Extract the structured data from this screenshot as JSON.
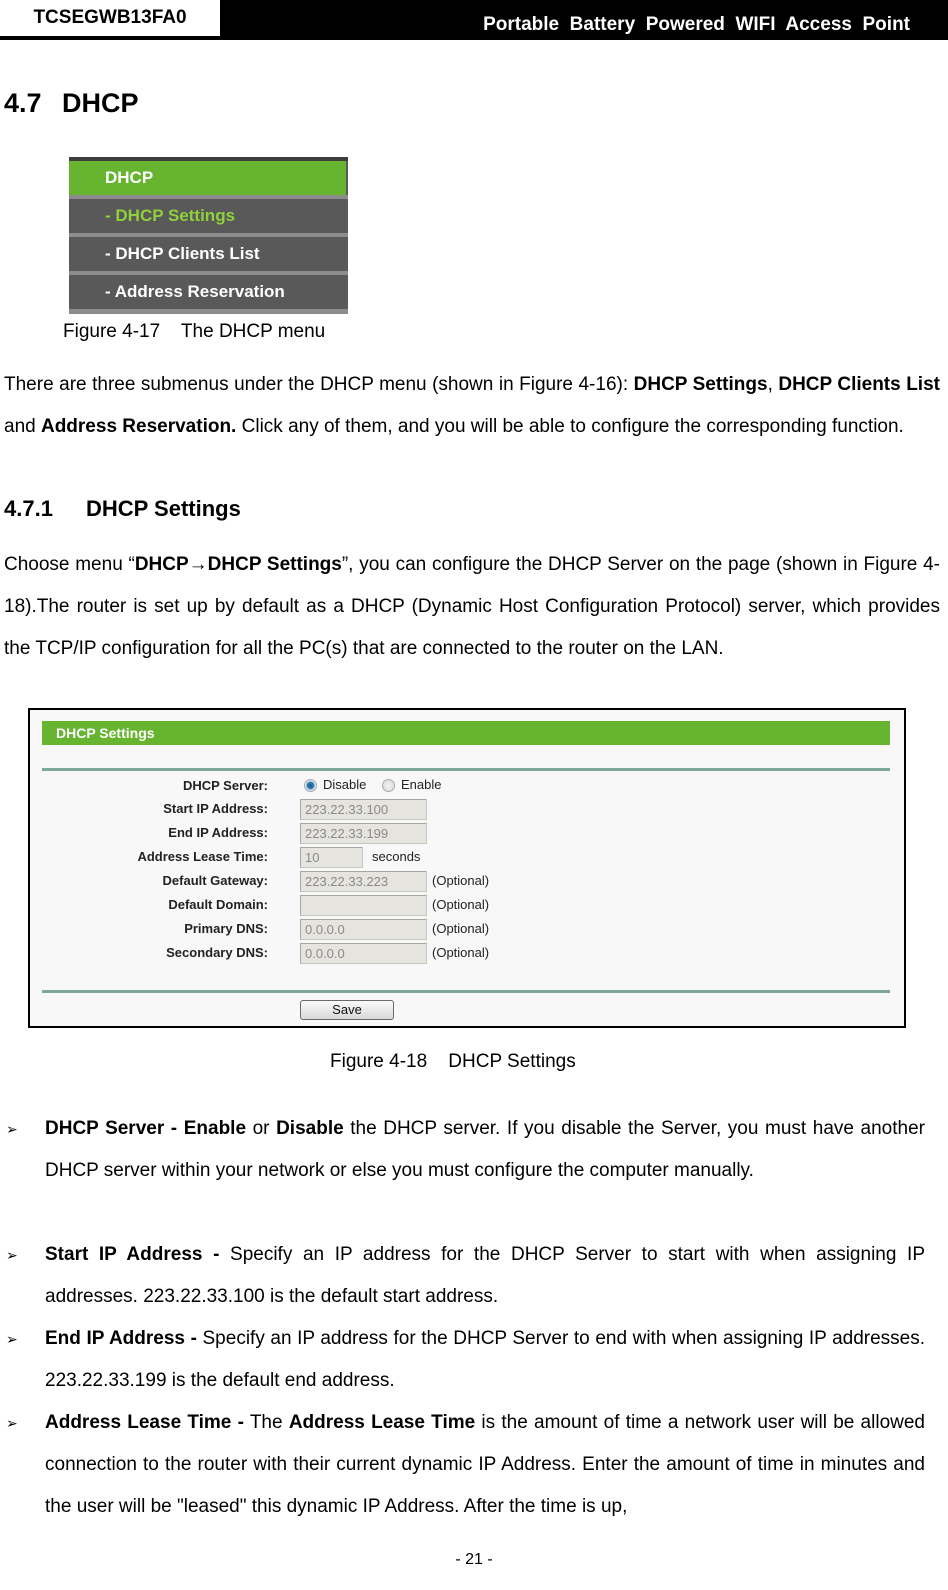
{
  "header": {
    "doc_id": "TCSEGWB13FA0",
    "product": "Portable  Battery  Powered  WIFI  Access  Point"
  },
  "section": {
    "number": "4.7",
    "title": "DHCP"
  },
  "menu": {
    "head": "DHCP",
    "items": [
      {
        "label": "- DHCP Settings",
        "active": true
      },
      {
        "label": "- DHCP Clients List",
        "active": false
      },
      {
        "label": "- Address Reservation",
        "active": false
      }
    ],
    "colors": {
      "head_bg": "#66b42f",
      "item_bg": "#595959",
      "active_text": "#8fd13a"
    }
  },
  "figure1_caption": "Figure 4-17    The DHCP menu",
  "intro_paragraph": {
    "t1": "There are three submenus under the DHCP menu (shown in Figure 4-16): ",
    "b1": "DHCP Settings",
    "t2": ", ",
    "b2": "DHCP Clients List",
    "t3": " and ",
    "b3": "Address Reservation.",
    "t4": " Click any of them, and you will be able to configure the corresponding function."
  },
  "subsection": {
    "number": "4.7.1",
    "title": "DHCP Settings"
  },
  "settings_paragraph": {
    "t1": "Choose menu “",
    "b1": "DHCP→DHCP Settings",
    "t2": "”, you can configure the DHCP Server on the page (shown in Figure 4-18).The router is set up by default as a DHCP (Dynamic Host Configuration Protocol) server, which provides the TCP/IP configuration for all the PC(s) that are connected to the router on the LAN."
  },
  "settings_form": {
    "title": "DHCP Settings",
    "server": {
      "label": "DHCP Server:",
      "options": [
        "Disable",
        "Enable"
      ],
      "selected": "Disable"
    },
    "fields": [
      {
        "label": "Start IP Address:",
        "value": "223.22.33.100",
        "note": ""
      },
      {
        "label": "End IP Address:",
        "value": "223.22.33.199",
        "note": ""
      },
      {
        "label": "Address Lease Time:",
        "value": "10",
        "note": "seconds"
      },
      {
        "label": "Default Gateway:",
        "value": "223.22.33.223",
        "note": "(Optional)"
      },
      {
        "label": "Default Domain:",
        "value": "",
        "note": "(Optional)"
      },
      {
        "label": "Primary DNS:",
        "value": "0.0.0.0",
        "note": "(Optional)"
      },
      {
        "label": "Secondary DNS:",
        "value": "0.0.0.0",
        "note": "(Optional)"
      }
    ],
    "save_label": "Save",
    "accent_color": "#66b42f"
  },
  "figure2_caption": "Figure 4-18    DHCP Settings",
  "bullets": [
    {
      "b1": "DHCP Server - Enable",
      "t1": " or ",
      "b2": "Disable",
      "t2": " the DHCP server. If you disable the Server, you must have another DHCP server within your network or else you must configure the computer manually."
    },
    {
      "b1": "Start IP Address -",
      "t1": " Specify an IP address for the DHCP Server to start with when assigning IP addresses. 223.22.33.100 is the default start address.",
      "b2": "",
      "t2": ""
    },
    {
      "b1": "End IP Address -",
      "t1": " Specify an IP address for the DHCP Server to end with when assigning IP addresses. 223.22.33.199 is the default end address.",
      "b2": "",
      "t2": ""
    },
    {
      "b1": "Address Lease Time -",
      "t1": " The ",
      "b2": "Address Lease Time",
      "t2": " is the amount of time a network user will be allowed connection to the router with their current dynamic IP Address. Enter the amount of time in minutes and the user will be \"leased\" this dynamic IP Address. After the time is up,"
    }
  ],
  "bullet_glyph": "➢",
  "page_number": "- 21 -"
}
